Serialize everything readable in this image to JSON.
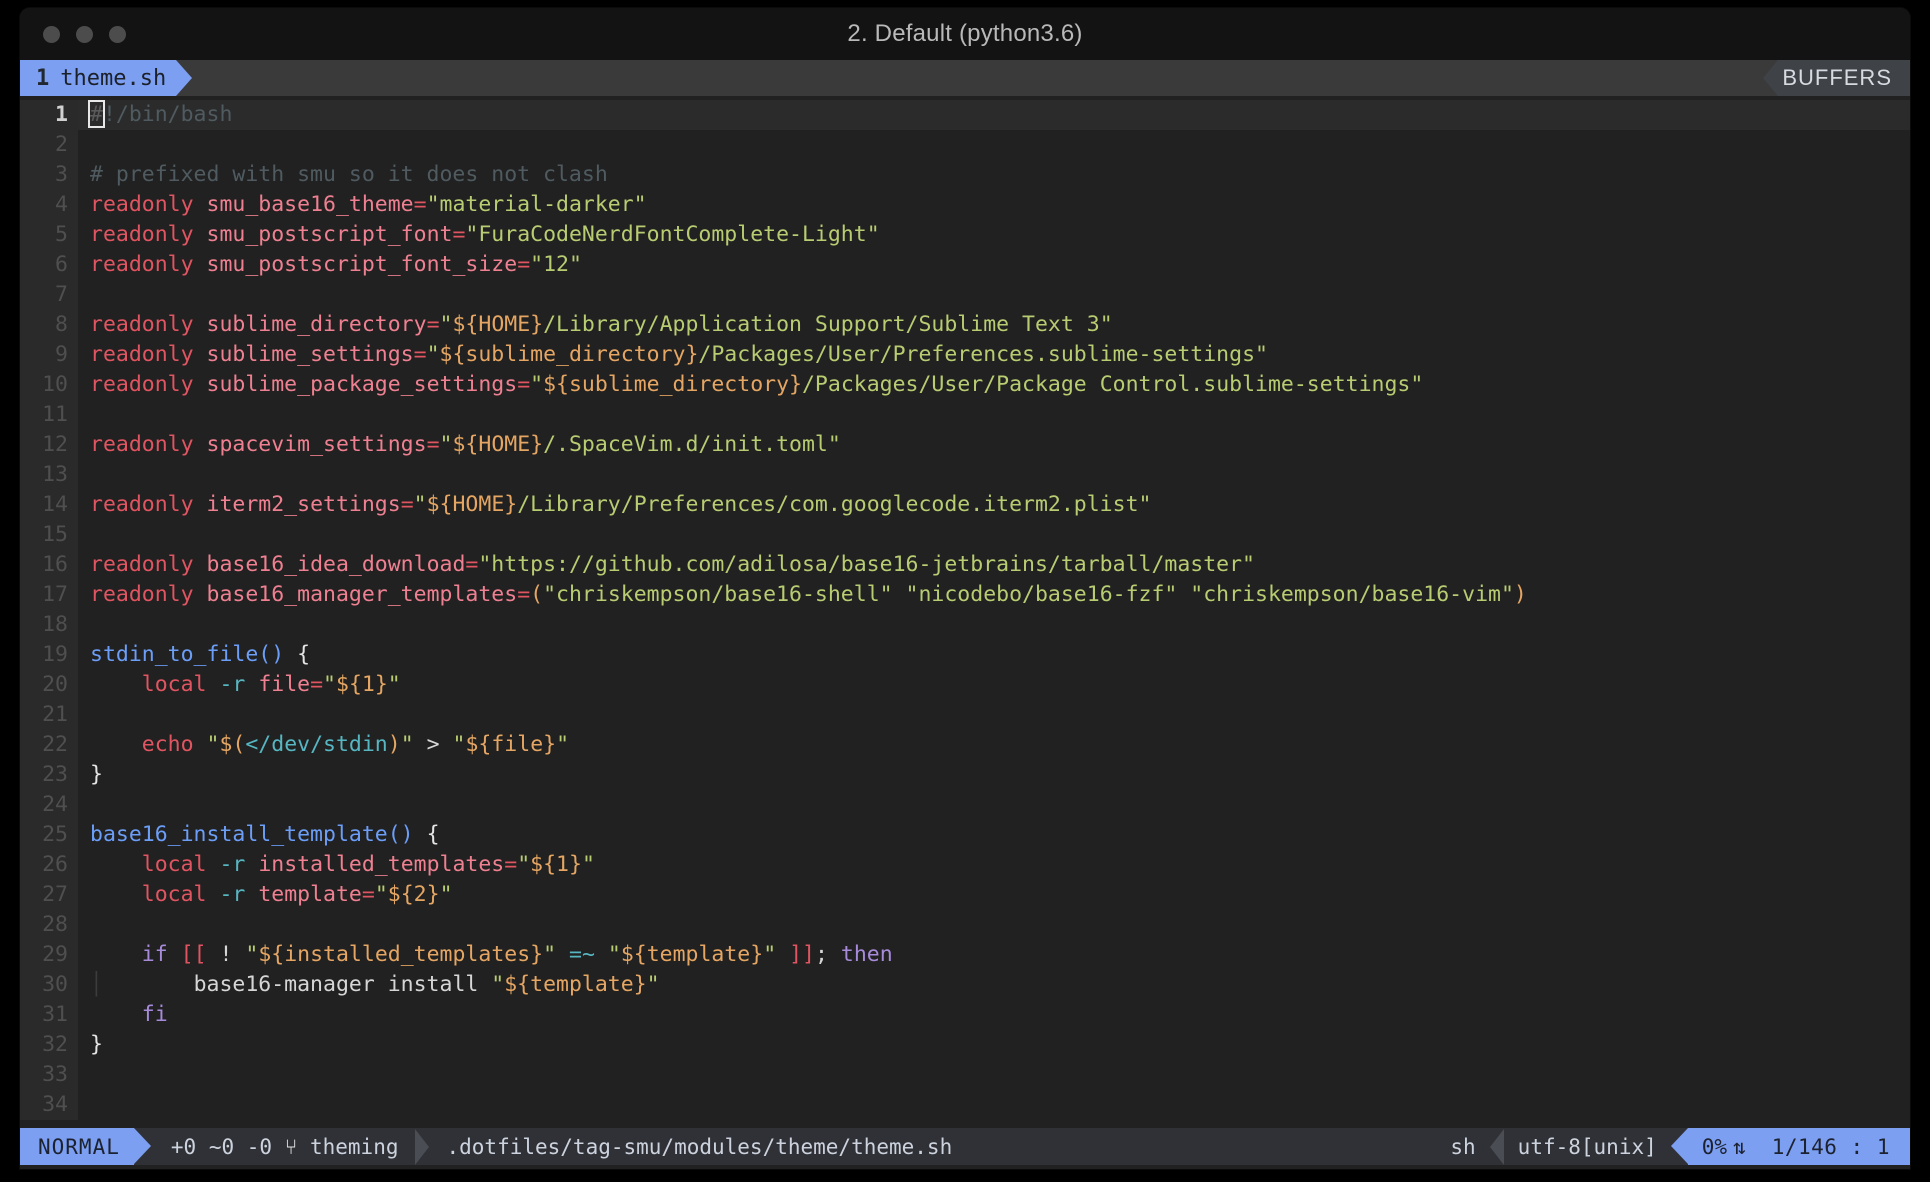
{
  "window": {
    "title": "2. Default (python3.6)",
    "traffic_lights": [
      "close",
      "minimize",
      "maximize"
    ]
  },
  "tabline": {
    "tab_number": "1",
    "tab_name": "theme.sh",
    "buffers_label": "BUFFERS"
  },
  "editor": {
    "lines": [
      {
        "n": "1",
        "current": true,
        "tokens": [
          {
            "t": "#",
            "c": "cursor"
          },
          {
            "t": "!/bin/bash",
            "c": "c-comment"
          }
        ]
      },
      {
        "n": "2",
        "tokens": []
      },
      {
        "n": "3",
        "tokens": [
          {
            "t": "# prefixed with smu so it does not clash",
            "c": "c-comment"
          }
        ]
      },
      {
        "n": "4",
        "tokens": [
          {
            "t": "readonly",
            "c": "c-kw"
          },
          {
            "t": " ",
            "c": "c-plain"
          },
          {
            "t": "smu_base16_theme",
            "c": "c-var"
          },
          {
            "t": "=",
            "c": "c-op"
          },
          {
            "t": "\"material-darker\"",
            "c": "c-str"
          }
        ]
      },
      {
        "n": "5",
        "tokens": [
          {
            "t": "readonly",
            "c": "c-kw"
          },
          {
            "t": " ",
            "c": "c-plain"
          },
          {
            "t": "smu_postscript_font",
            "c": "c-var"
          },
          {
            "t": "=",
            "c": "c-op"
          },
          {
            "t": "\"FuraCodeNerdFontComplete-Light\"",
            "c": "c-str"
          }
        ]
      },
      {
        "n": "6",
        "tokens": [
          {
            "t": "readonly",
            "c": "c-kw"
          },
          {
            "t": " ",
            "c": "c-plain"
          },
          {
            "t": "smu_postscript_font_size",
            "c": "c-var"
          },
          {
            "t": "=",
            "c": "c-op"
          },
          {
            "t": "\"12\"",
            "c": "c-str"
          }
        ]
      },
      {
        "n": "7",
        "tokens": []
      },
      {
        "n": "8",
        "tokens": [
          {
            "t": "readonly",
            "c": "c-kw"
          },
          {
            "t": " ",
            "c": "c-plain"
          },
          {
            "t": "sublime_directory",
            "c": "c-var"
          },
          {
            "t": "=",
            "c": "c-op"
          },
          {
            "t": "\"",
            "c": "c-str"
          },
          {
            "t": "${HOME}",
            "c": "c-subst"
          },
          {
            "t": "/Library/Application Support/Sublime Text 3\"",
            "c": "c-str"
          }
        ]
      },
      {
        "n": "9",
        "tokens": [
          {
            "t": "readonly",
            "c": "c-kw"
          },
          {
            "t": " ",
            "c": "c-plain"
          },
          {
            "t": "sublime_settings",
            "c": "c-var"
          },
          {
            "t": "=",
            "c": "c-op"
          },
          {
            "t": "\"",
            "c": "c-str"
          },
          {
            "t": "${sublime_directory}",
            "c": "c-subst"
          },
          {
            "t": "/Packages/User/Preferences.sublime-settings\"",
            "c": "c-str"
          }
        ]
      },
      {
        "n": "10",
        "tokens": [
          {
            "t": "readonly",
            "c": "c-kw"
          },
          {
            "t": " ",
            "c": "c-plain"
          },
          {
            "t": "sublime_package_settings",
            "c": "c-var"
          },
          {
            "t": "=",
            "c": "c-op"
          },
          {
            "t": "\"",
            "c": "c-str"
          },
          {
            "t": "${sublime_directory}",
            "c": "c-subst"
          },
          {
            "t": "/Packages/User/Package Control.sublime-settings\"",
            "c": "c-str"
          }
        ]
      },
      {
        "n": "11",
        "tokens": []
      },
      {
        "n": "12",
        "tokens": [
          {
            "t": "readonly",
            "c": "c-kw"
          },
          {
            "t": " ",
            "c": "c-plain"
          },
          {
            "t": "spacevim_settings",
            "c": "c-var"
          },
          {
            "t": "=",
            "c": "c-op"
          },
          {
            "t": "\"",
            "c": "c-str"
          },
          {
            "t": "${HOME}",
            "c": "c-subst"
          },
          {
            "t": "/.SpaceVim.d/init.toml\"",
            "c": "c-str"
          }
        ]
      },
      {
        "n": "13",
        "tokens": []
      },
      {
        "n": "14",
        "tokens": [
          {
            "t": "readonly",
            "c": "c-kw"
          },
          {
            "t": " ",
            "c": "c-plain"
          },
          {
            "t": "iterm2_settings",
            "c": "c-var"
          },
          {
            "t": "=",
            "c": "c-op"
          },
          {
            "t": "\"",
            "c": "c-str"
          },
          {
            "t": "${HOME}",
            "c": "c-subst"
          },
          {
            "t": "/Library/Preferences/com.googlecode.iterm2.plist\"",
            "c": "c-str"
          }
        ]
      },
      {
        "n": "15",
        "tokens": []
      },
      {
        "n": "16",
        "tokens": [
          {
            "t": "readonly",
            "c": "c-kw"
          },
          {
            "t": " ",
            "c": "c-plain"
          },
          {
            "t": "base16_idea_download",
            "c": "c-var"
          },
          {
            "t": "=",
            "c": "c-op"
          },
          {
            "t": "\"https://github.com/adilosa/base16-jetbrains/tarball/master\"",
            "c": "c-str"
          }
        ]
      },
      {
        "n": "17",
        "tokens": [
          {
            "t": "readonly",
            "c": "c-kw"
          },
          {
            "t": " ",
            "c": "c-plain"
          },
          {
            "t": "base16_manager_templates",
            "c": "c-var"
          },
          {
            "t": "=",
            "c": "c-op"
          },
          {
            "t": "(",
            "c": "c-paren"
          },
          {
            "t": "\"chriskempson/base16-shell\" \"nicodebo/base16-fzf\" \"chriskempson/base16-vim\"",
            "c": "c-str"
          },
          {
            "t": ")",
            "c": "c-paren"
          }
        ]
      },
      {
        "n": "18",
        "tokens": []
      },
      {
        "n": "19",
        "tokens": [
          {
            "t": "stdin_to_file",
            "c": "c-fn"
          },
          {
            "t": "()",
            "c": "c-fn"
          },
          {
            "t": " ",
            "c": "c-plain"
          },
          {
            "t": "{",
            "c": "c-punct"
          }
        ]
      },
      {
        "n": "20",
        "tokens": [
          {
            "t": "    ",
            "c": "c-plain"
          },
          {
            "t": "local",
            "c": "c-kw"
          },
          {
            "t": " ",
            "c": "c-plain"
          },
          {
            "t": "-r",
            "c": "c-flag"
          },
          {
            "t": " ",
            "c": "c-plain"
          },
          {
            "t": "file",
            "c": "c-var"
          },
          {
            "t": "=",
            "c": "c-op"
          },
          {
            "t": "\"",
            "c": "c-str"
          },
          {
            "t": "${1}",
            "c": "c-subst"
          },
          {
            "t": "\"",
            "c": "c-str"
          }
        ]
      },
      {
        "n": "21",
        "tokens": []
      },
      {
        "n": "22",
        "tokens": [
          {
            "t": "    ",
            "c": "c-plain"
          },
          {
            "t": "echo",
            "c": "c-kw"
          },
          {
            "t": " ",
            "c": "c-plain"
          },
          {
            "t": "\"",
            "c": "c-str"
          },
          {
            "t": "$(",
            "c": "c-subst"
          },
          {
            "t": "</dev/stdin",
            "c": "c-flag"
          },
          {
            "t": ")",
            "c": "c-subst"
          },
          {
            "t": "\"",
            "c": "c-str"
          },
          {
            "t": " ",
            "c": "c-plain"
          },
          {
            "t": ">",
            "c": "c-plain"
          },
          {
            "t": " ",
            "c": "c-plain"
          },
          {
            "t": "\"",
            "c": "c-str"
          },
          {
            "t": "${file}",
            "c": "c-subst"
          },
          {
            "t": "\"",
            "c": "c-str"
          }
        ]
      },
      {
        "n": "23",
        "tokens": [
          {
            "t": "}",
            "c": "c-punct"
          }
        ]
      },
      {
        "n": "24",
        "tokens": []
      },
      {
        "n": "25",
        "tokens": [
          {
            "t": "base16_install_template",
            "c": "c-fn"
          },
          {
            "t": "()",
            "c": "c-fn"
          },
          {
            "t": " ",
            "c": "c-plain"
          },
          {
            "t": "{",
            "c": "c-punct"
          }
        ]
      },
      {
        "n": "26",
        "tokens": [
          {
            "t": "    ",
            "c": "c-plain"
          },
          {
            "t": "local",
            "c": "c-kw"
          },
          {
            "t": " ",
            "c": "c-plain"
          },
          {
            "t": "-r",
            "c": "c-flag"
          },
          {
            "t": " ",
            "c": "c-plain"
          },
          {
            "t": "installed_templates",
            "c": "c-var"
          },
          {
            "t": "=",
            "c": "c-op"
          },
          {
            "t": "\"",
            "c": "c-str"
          },
          {
            "t": "${1}",
            "c": "c-subst"
          },
          {
            "t": "\"",
            "c": "c-str"
          }
        ]
      },
      {
        "n": "27",
        "tokens": [
          {
            "t": "    ",
            "c": "c-plain"
          },
          {
            "t": "local",
            "c": "c-kw"
          },
          {
            "t": " ",
            "c": "c-plain"
          },
          {
            "t": "-r",
            "c": "c-flag"
          },
          {
            "t": " ",
            "c": "c-plain"
          },
          {
            "t": "template",
            "c": "c-var"
          },
          {
            "t": "=",
            "c": "c-op"
          },
          {
            "t": "\"",
            "c": "c-str"
          },
          {
            "t": "${2}",
            "c": "c-subst"
          },
          {
            "t": "\"",
            "c": "c-str"
          }
        ]
      },
      {
        "n": "28",
        "tokens": []
      },
      {
        "n": "29",
        "tokens": [
          {
            "t": "    ",
            "c": "c-plain"
          },
          {
            "t": "if",
            "c": "c-ctrl"
          },
          {
            "t": " ",
            "c": "c-plain"
          },
          {
            "t": "[[",
            "c": "c-bracket"
          },
          {
            "t": " ",
            "c": "c-plain"
          },
          {
            "t": "!",
            "c": "c-plain"
          },
          {
            "t": " ",
            "c": "c-plain"
          },
          {
            "t": "\"",
            "c": "c-str"
          },
          {
            "t": "${installed_templates}",
            "c": "c-subst"
          },
          {
            "t": "\"",
            "c": "c-str"
          },
          {
            "t": " ",
            "c": "c-plain"
          },
          {
            "t": "=~",
            "c": "c-flag"
          },
          {
            "t": " ",
            "c": "c-plain"
          },
          {
            "t": "\"",
            "c": "c-str"
          },
          {
            "t": "${template}",
            "c": "c-subst"
          },
          {
            "t": "\"",
            "c": "c-str"
          },
          {
            "t": " ",
            "c": "c-plain"
          },
          {
            "t": "]]",
            "c": "c-bracket"
          },
          {
            "t": ";",
            "c": "c-plain"
          },
          {
            "t": " ",
            "c": "c-plain"
          },
          {
            "t": "then",
            "c": "c-ctrl"
          }
        ]
      },
      {
        "n": "30",
        "tokens": [
          {
            "t": "    ",
            "c": "indent-guide",
            "guide": true
          },
          {
            "t": "    ",
            "c": "c-plain"
          },
          {
            "t": "base16-manager install ",
            "c": "c-plain"
          },
          {
            "t": "\"",
            "c": "c-str"
          },
          {
            "t": "${template}",
            "c": "c-subst"
          },
          {
            "t": "\"",
            "c": "c-str"
          }
        ]
      },
      {
        "n": "31",
        "tokens": [
          {
            "t": "    ",
            "c": "c-plain"
          },
          {
            "t": "fi",
            "c": "c-ctrl"
          }
        ]
      },
      {
        "n": "32",
        "tokens": [
          {
            "t": "}",
            "c": "c-punct"
          }
        ]
      },
      {
        "n": "33",
        "tokens": []
      },
      {
        "n": "34",
        "tokens": []
      }
    ]
  },
  "statusline": {
    "mode": "NORMAL",
    "git_added": "+0",
    "git_modified": "~0",
    "git_removed": "-0",
    "branch_icon": "⑂",
    "branch": "theming",
    "filepath": ".dotfiles/tag-smu/modules/theme/theme.sh",
    "filetype": "sh",
    "encoding": "utf-8[unix]",
    "percent": "0%",
    "percent_icon": "⇅",
    "line_position": "1/146 :    1"
  },
  "colors": {
    "accent_blue": "#7c9ff2",
    "editor_bg": "#212121",
    "gutter_bg": "#2a2a2a",
    "titlebar_bg": "#131313",
    "tabline_bg": "#3a3a3a",
    "statusline_bg": "#2f3136",
    "string_green": "#b8cc72",
    "keyword_red": "#e05561",
    "subst_orange": "#e5a663",
    "fn_blue": "#6c9ef8",
    "ctrl_purple": "#a78bda",
    "flag_cyan": "#56b6c2",
    "comment_gray": "#4f5b60"
  }
}
